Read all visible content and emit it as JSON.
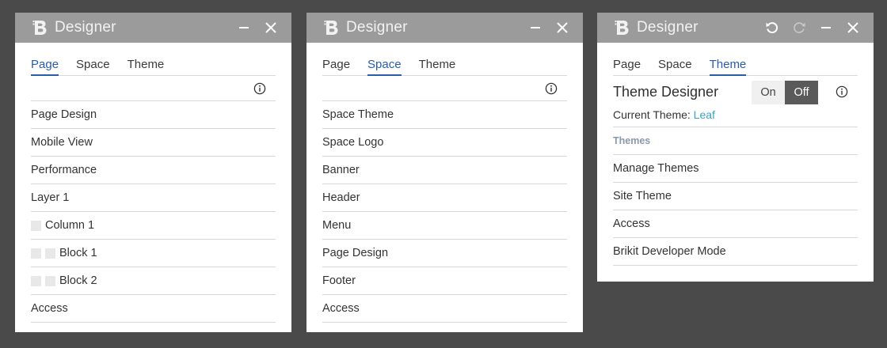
{
  "colors": {
    "background": "#4a4a4a",
    "titlebar": "#9b9b9b",
    "accent": "#2a5ca8",
    "link": "#3aa0c4",
    "section_header": "#8a98ad"
  },
  "panels": [
    {
      "title": "Designer",
      "tabs": [
        {
          "label": "Page",
          "active": true
        },
        {
          "label": "Space",
          "active": false
        },
        {
          "label": "Theme",
          "active": false
        }
      ],
      "items": [
        {
          "label": "Page Design",
          "indent": 0
        },
        {
          "label": "Mobile View",
          "indent": 0
        },
        {
          "label": "Performance",
          "indent": 0
        },
        {
          "label": "Layer 1",
          "indent": 0
        },
        {
          "label": "Column 1",
          "indent": 1
        },
        {
          "label": "Block 1",
          "indent": 2
        },
        {
          "label": "Block 2",
          "indent": 2
        },
        {
          "label": "Access",
          "indent": 0
        }
      ]
    },
    {
      "title": "Designer",
      "tabs": [
        {
          "label": "Page",
          "active": false
        },
        {
          "label": "Space",
          "active": true
        },
        {
          "label": "Theme",
          "active": false
        }
      ],
      "items": [
        {
          "label": "Space Theme"
        },
        {
          "label": "Space Logo"
        },
        {
          "label": "Banner"
        },
        {
          "label": "Header"
        },
        {
          "label": "Menu"
        },
        {
          "label": "Page Design"
        },
        {
          "label": "Footer"
        },
        {
          "label": "Access"
        }
      ]
    },
    {
      "title": "Designer",
      "tabs": [
        {
          "label": "Page",
          "active": false
        },
        {
          "label": "Space",
          "active": false
        },
        {
          "label": "Theme",
          "active": true
        }
      ],
      "theme_designer": {
        "title": "Theme Designer",
        "toggle_on": "On",
        "toggle_off": "Off",
        "selected": "Off",
        "current_label": "Current Theme:",
        "current_value": "Leaf"
      },
      "section_header": "Themes",
      "items": [
        {
          "label": "Manage Themes"
        },
        {
          "label": "Site Theme"
        },
        {
          "label": "Access"
        },
        {
          "label": "Brikit Developer Mode"
        }
      ]
    }
  ],
  "icons": {
    "logo": "brikit-b-logo-icon",
    "minimize": "minimize-icon",
    "close": "close-icon",
    "undo": "undo-icon",
    "redo": "redo-icon",
    "info": "info-icon"
  }
}
